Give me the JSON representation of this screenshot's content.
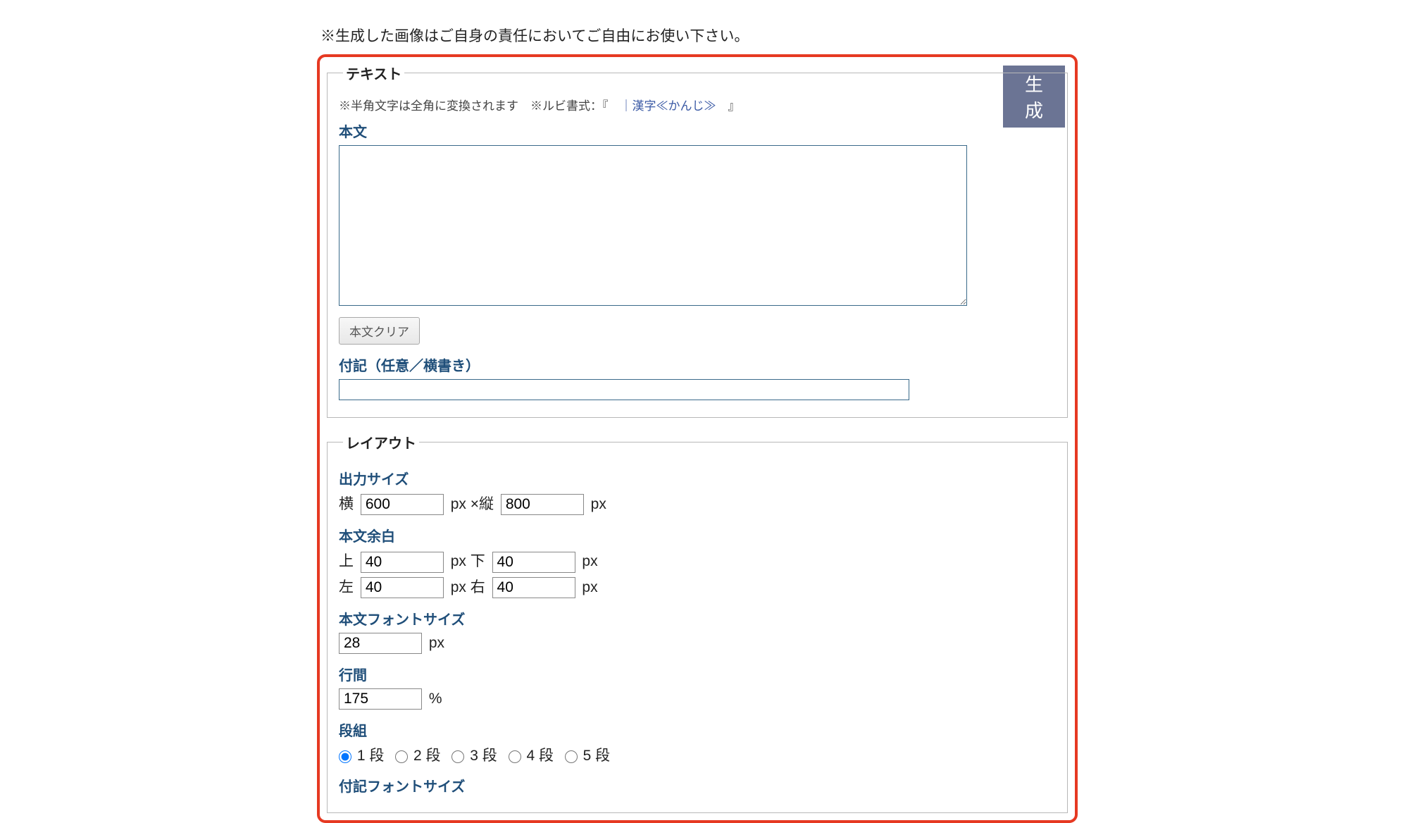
{
  "topNote": "※生成した画像はご自身の責任においてご自由にお使い下さい。",
  "generateButton": "生 成",
  "textSection": {
    "legend": "テキスト",
    "notePrefix": "※半角文字は全角に変換されます　※ルビ書式：『　",
    "rubyExample": "｜漢字≪かんじ≫",
    "noteSuffix": "　』",
    "bodyLabel": "本文",
    "bodyValue": "",
    "clearButton": "本文クリア",
    "noteLabel": "付記（任意／横書き）",
    "noteValue": ""
  },
  "layoutSection": {
    "legend": "レイアウト",
    "outputSize": {
      "label": "出力サイズ",
      "widthLabel": "横",
      "widthValue": "600",
      "pxXHeight": "px ×縦",
      "heightValue": "800",
      "pxSuffix": "px"
    },
    "margin": {
      "label": "本文余白",
      "topLabel": "上",
      "topValue": "40",
      "bottomLabel": "px 下",
      "bottomValue": "40",
      "leftLabel": "左",
      "leftValue": "40",
      "rightLabel": "px 右",
      "rightValue": "40",
      "pxSuffix": "px"
    },
    "fontSize": {
      "label": "本文フォントサイズ",
      "value": "28",
      "suffix": "px"
    },
    "lineHeight": {
      "label": "行間",
      "value": "175",
      "suffix": "%"
    },
    "columns": {
      "label": "段組",
      "options": [
        "1 段",
        "2 段",
        "3 段",
        "4 段",
        "5 段"
      ],
      "selected": 0
    },
    "noteFontSize": {
      "label": "付記フォントサイズ"
    }
  }
}
